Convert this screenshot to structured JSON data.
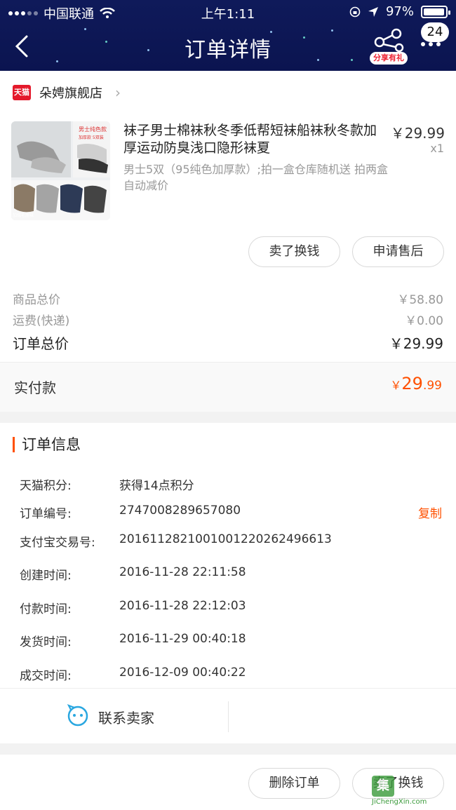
{
  "status_bar": {
    "carrier": "中国联通",
    "time": "上午1:11",
    "battery": "97%"
  },
  "header": {
    "title": "订单详情",
    "share_label": "分享有礼",
    "badge_count": "24"
  },
  "shop": {
    "platform_badge": "天猫",
    "name": "朵娉旗舰店"
  },
  "item": {
    "title": "袜子男士棉袜秋冬季低帮短袜船袜秋冬款加厚运动防臭浅口隐形袜夏",
    "sku": "男士5双（95纯色加厚款）;拍一盒仓库随机送 拍两盒自动减价",
    "price": "￥29.99",
    "qty": "x1",
    "thumb_text_1": "男士纯色款",
    "thumb_text_2": "加厚款 5双装",
    "thumb_text_3": "加绒毛圈袜"
  },
  "item_actions": {
    "sell": "卖了换钱",
    "after_sale": "申请售后"
  },
  "summary": {
    "goods_label": "商品总价",
    "goods_value": "￥58.80",
    "shipping_label": "运费(快递)",
    "shipping_value": "￥0.00",
    "total_label": "订单总价",
    "total_value": "￥29.99",
    "paid_label": "实付款",
    "paid_currency": "￥",
    "paid_int": "29",
    "paid_dec": ".99"
  },
  "order_info": {
    "heading": "订单信息",
    "rows": [
      {
        "k": "天猫积分:",
        "v": "获得14点积分"
      },
      {
        "k": "订单编号:",
        "v": "2747008289657080"
      },
      {
        "k": "支付宝交易号:",
        "v": "2016112821001001220262496613"
      },
      {
        "k": "创建时间:",
        "v": "2016-11-28 22:11:58"
      },
      {
        "k": "付款时间:",
        "v": "2016-11-28 22:12:03"
      },
      {
        "k": "发货时间:",
        "v": "2016-11-29 00:40:18"
      },
      {
        "k": "成交时间:",
        "v": "2016-12-09 00:40:22"
      }
    ],
    "copy_label": "复制",
    "contact_seller": "联系卖家"
  },
  "bottom": {
    "delete_order": "删除订单",
    "sell": "卖了换钱"
  },
  "watermark": {
    "glyph": "集",
    "site": "JiChengXin.com"
  },
  "colors": {
    "accent": "#ff5000",
    "header_bg": "#0f1a5a",
    "tmall_red": "#e4192b"
  }
}
